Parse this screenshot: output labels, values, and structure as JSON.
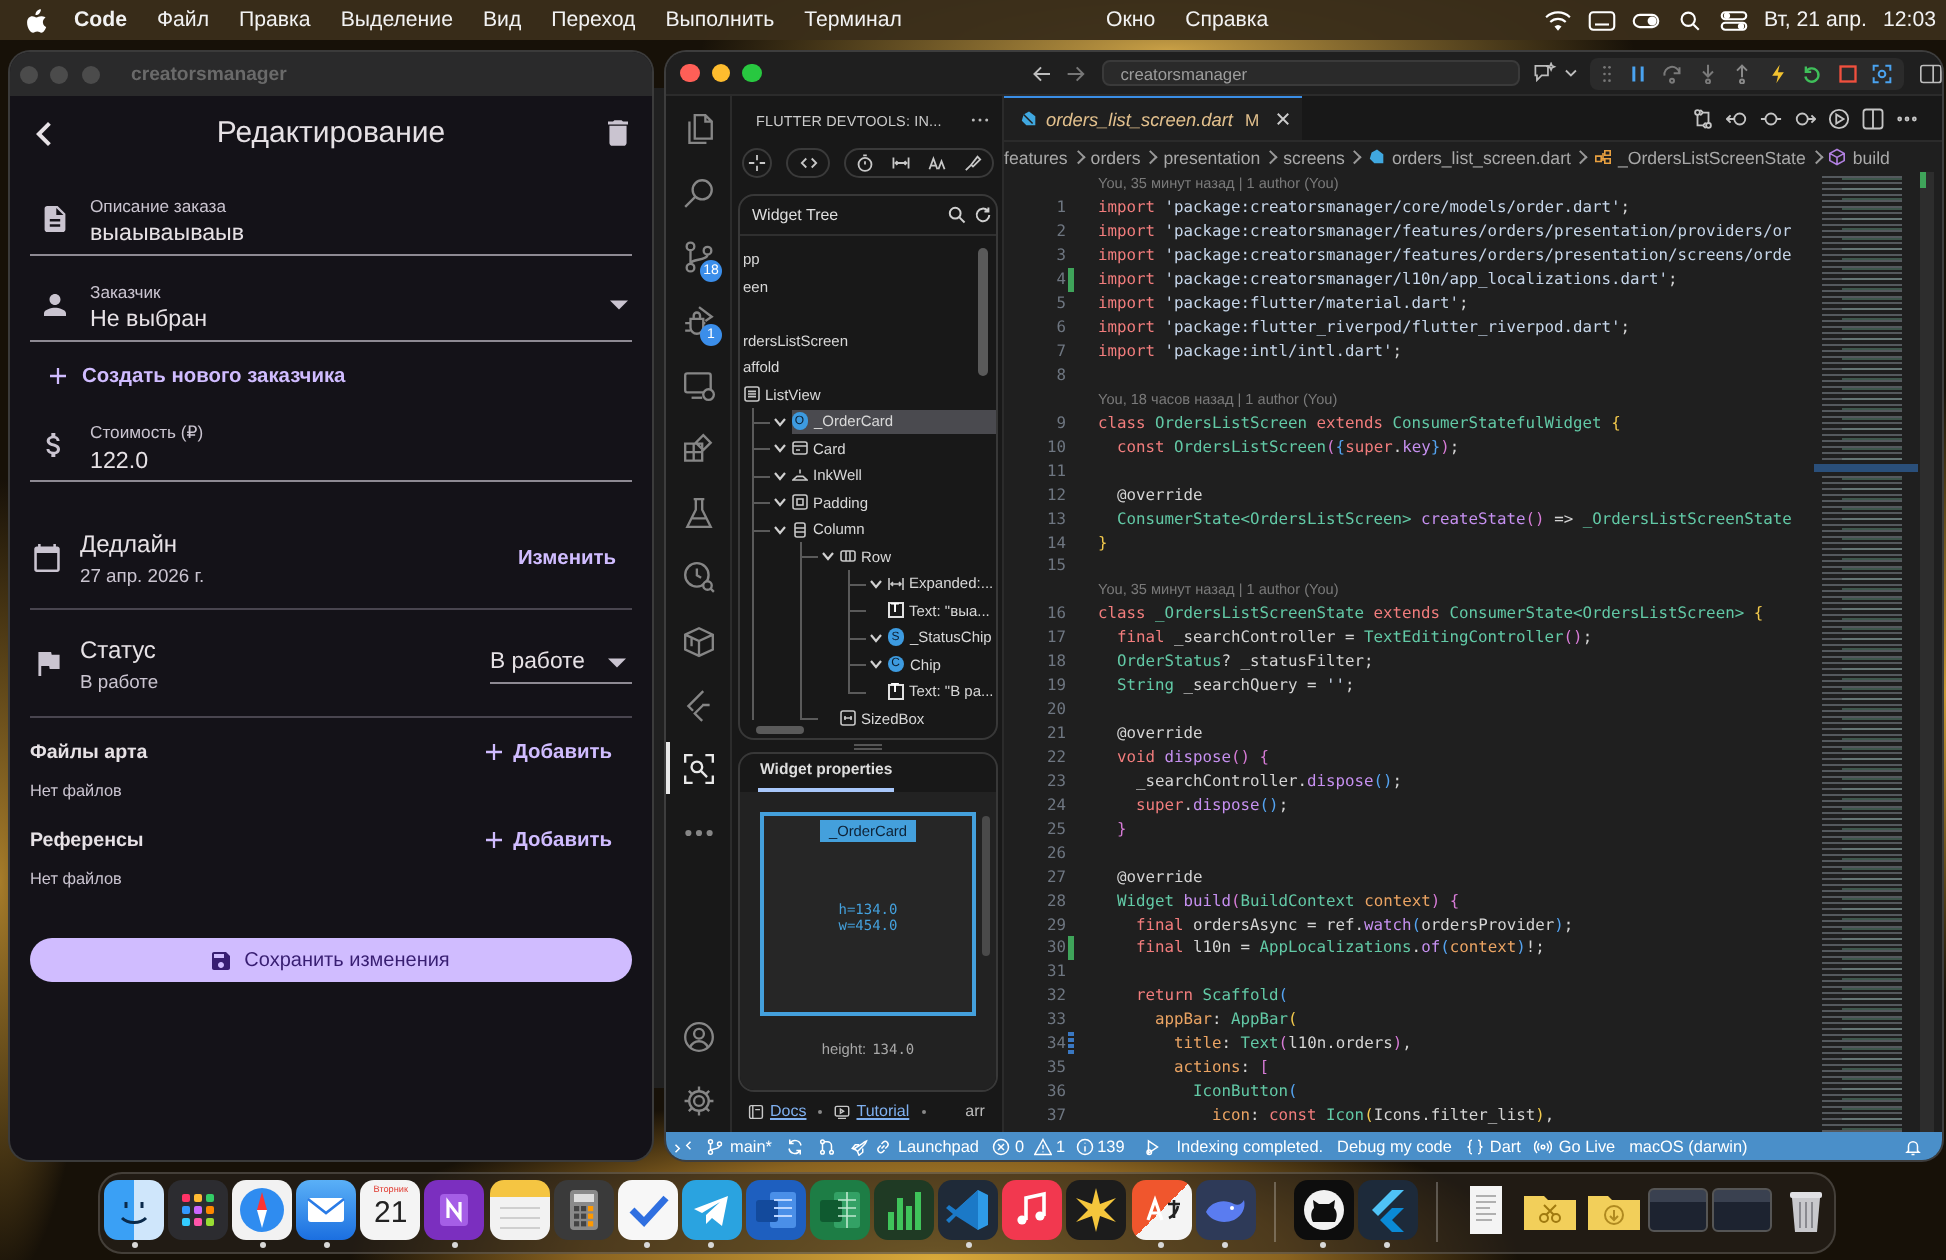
{
  "menu_bar": {
    "app_name": "Code",
    "menus": [
      "Файл",
      "Правка",
      "Выделение",
      "Вид",
      "Переход",
      "Выполнить",
      "Терминал"
    ],
    "more_menus": [
      "Окно",
      "Справка"
    ],
    "date": "Вт, 21 апр.",
    "time": "12:03"
  },
  "app_window": {
    "title": "creatorsmanager",
    "focused": false,
    "header_title": "Редактирование",
    "description_field": {
      "label": "Описание заказа",
      "value": "выаываываыв"
    },
    "customer_field": {
      "label": "Заказчик",
      "value": "Не выбран"
    },
    "create_customer_link": "Создать нового заказчика",
    "price_field": {
      "label": "Стоимость (₽)",
      "value": "122.0"
    },
    "deadline": {
      "title": "Дедлайн",
      "value": "27 апр. 2026 г.",
      "action": "Изменить"
    },
    "status": {
      "title": "Статус",
      "value": "В работе",
      "selected_option": "В работе"
    },
    "attachment_sections": [
      {
        "title": "Файлы арта",
        "add_label": "Добавить",
        "empty_text": "Нет файлов"
      },
      {
        "title": "Референсы",
        "add_label": "Добавить",
        "empty_text": "Нет файлов"
      }
    ],
    "save_button": "Сохранить изменения"
  },
  "editor_window": {
    "focused": true,
    "command_center": "creatorsmanager",
    "activity_bar": [
      {
        "kind": "explorer",
        "selected": false
      },
      {
        "kind": "search",
        "selected": false
      },
      {
        "kind": "scm",
        "selected": false,
        "badge": "18"
      },
      {
        "kind": "debug",
        "selected": false,
        "badge": "1"
      },
      {
        "kind": "remote",
        "selected": false
      },
      {
        "kind": "extensions",
        "selected": false
      },
      {
        "kind": "testing",
        "selected": false
      },
      {
        "kind": "history",
        "selected": false
      },
      {
        "kind": "packages",
        "selected": false
      },
      {
        "kind": "flutter",
        "selected": false
      },
      {
        "kind": "inspector",
        "selected": true
      },
      {
        "kind": "more",
        "selected": false
      }
    ],
    "side_panel": {
      "title": "FLUTTER DEVTOOLS: IN...",
      "widget_tree": {
        "title": "Widget Tree",
        "nodes": [
          {
            "name": "pp",
            "selected": false
          },
          {
            "name": "een",
            "selected": false
          },
          {
            "name": "rdersListScreen",
            "selected": false
          },
          {
            "name": "affold",
            "selected": false
          },
          {
            "name": "ListView",
            "kind": "list",
            "selected": false,
            "children": [
              {
                "name": "_OrderCard",
                "kind": "widget",
                "letter": "O",
                "expanded": true,
                "selected": true
              },
              {
                "name": "Card",
                "kind": "card",
                "expanded": true,
                "selected": false
              },
              {
                "name": "InkWell",
                "kind": "ink",
                "expanded": true,
                "selected": false
              },
              {
                "name": "Padding",
                "kind": "padding",
                "expanded": true,
                "selected": false
              },
              {
                "name": "Column",
                "kind": "column",
                "expanded": true,
                "selected": false,
                "children": [
                  {
                    "name": "Row",
                    "kind": "row",
                    "expanded": true,
                    "selected": false,
                    "children": [
                      {
                        "name": "Expanded:...",
                        "kind": "expanded",
                        "expanded": true,
                        "selected": false
                      },
                      {
                        "name": "Text: \"выа...",
                        "kind": "text",
                        "letter": "T",
                        "selected": false
                      },
                      {
                        "name": "_StatusChip",
                        "kind": "widget",
                        "letter": "S",
                        "expanded": true,
                        "selected": false
                      },
                      {
                        "name": "Chip",
                        "kind": "widget",
                        "letter": "C",
                        "expanded": true,
                        "selected": false
                      },
                      {
                        "name": "Text: \"В ра...",
                        "kind": "text",
                        "letter": "T",
                        "selected": false
                      }
                    ]
                  },
                  {
                    "name": "SizedBox",
                    "kind": "sizedbox",
                    "selected": false
                  }
                ]
              }
            ]
          }
        ]
      },
      "properties": {
        "tabs": [
          {
            "label": "Widget properties",
            "selected": true
          }
        ],
        "widget": "_OrderCard",
        "height_label": "h=134.0",
        "width_label": "w=454.0",
        "detail_name": "height:",
        "detail_value": "134.0"
      },
      "links": [
        {
          "kind": "book",
          "label": "Docs"
        },
        {
          "kind": "video",
          "label": "Tutorial"
        },
        {
          "label": "arr"
        }
      ]
    },
    "tabs": [
      {
        "label": "orders_list_screen.dart",
        "status": "M",
        "selected": true
      }
    ],
    "breadcrumbs": [
      {
        "label": "features"
      },
      {
        "label": "orders"
      },
      {
        "label": "presentation"
      },
      {
        "label": "screens"
      },
      {
        "label": "orders_list_screen.dart",
        "kind": "file"
      },
      {
        "label": "_OrdersListScreenState",
        "kind": "class"
      },
      {
        "label": "build",
        "kind": "method"
      }
    ],
    "lines": [
      {
        "kind": "blame",
        "text": "You, 35 минут назад | 1 author (You)"
      },
      {
        "kind": "code",
        "number": "1",
        "tokens": [
          {
            "kind": "keyword",
            "text": "import "
          },
          {
            "kind": "string",
            "text": "'package:creatorsmanager/core/models/order.dart'"
          },
          {
            "kind": "text",
            "text": ";"
          }
        ]
      },
      {
        "kind": "code",
        "number": "2",
        "tokens": [
          {
            "kind": "keyword",
            "text": "import "
          },
          {
            "kind": "string",
            "text": "'package:creatorsmanager/features/orders/presentation/providers/or"
          }
        ]
      },
      {
        "kind": "code",
        "number": "3",
        "tokens": [
          {
            "kind": "keyword",
            "text": "import "
          },
          {
            "kind": "string",
            "text": "'package:creatorsmanager/features/orders/presentation/screens/orde"
          }
        ]
      },
      {
        "kind": "code",
        "number": "4",
        "added": true,
        "tokens": [
          {
            "kind": "keyword",
            "text": "import "
          },
          {
            "kind": "string",
            "text": "'package:creatorsmanager/l10n/app_localizations.dart'"
          },
          {
            "kind": "text",
            "text": ";"
          }
        ]
      },
      {
        "kind": "code",
        "number": "5",
        "tokens": [
          {
            "kind": "keyword",
            "text": "import "
          },
          {
            "kind": "string",
            "text": "'package:flutter/material.dart'"
          },
          {
            "kind": "text",
            "text": ";"
          }
        ]
      },
      {
        "kind": "code",
        "number": "6",
        "tokens": [
          {
            "kind": "keyword",
            "text": "import "
          },
          {
            "kind": "string",
            "text": "'package:flutter_riverpod/flutter_riverpod.dart'"
          },
          {
            "kind": "text",
            "text": ";"
          }
        ]
      },
      {
        "kind": "code",
        "number": "7",
        "tokens": [
          {
            "kind": "keyword",
            "text": "import "
          },
          {
            "kind": "string",
            "text": "'package:intl/intl.dart'"
          },
          {
            "kind": "text",
            "text": ";"
          }
        ]
      },
      {
        "kind": "code",
        "number": "8"
      },
      {
        "kind": "blame",
        "text": "You, 18 часов назад | 1 author (You)"
      },
      {
        "kind": "code",
        "number": "9",
        "tokens": [
          {
            "kind": "keyword",
            "text": "class "
          },
          {
            "kind": "type",
            "text": "OrdersListScreen "
          },
          {
            "kind": "keyword",
            "text": "extends "
          },
          {
            "kind": "type",
            "text": "ConsumerStatefulWidget "
          },
          {
            "kind": "brace1",
            "text": "{"
          }
        ]
      },
      {
        "kind": "code",
        "number": "10",
        "tokens": [
          {
            "kind": "keyword",
            "text": "  const "
          },
          {
            "kind": "type",
            "text": "OrdersListScreen"
          },
          {
            "kind": "brace2",
            "text": "("
          },
          {
            "kind": "brace3",
            "text": "{"
          },
          {
            "kind": "keyword",
            "text": "super"
          },
          {
            "kind": "text",
            "text": "."
          },
          {
            "kind": "function",
            "text": "key"
          },
          {
            "kind": "brace3",
            "text": "}"
          },
          {
            "kind": "brace2",
            "text": ")"
          },
          {
            "kind": "text",
            "text": ";"
          }
        ]
      },
      {
        "kind": "code",
        "number": "11"
      },
      {
        "kind": "code",
        "number": "12",
        "tokens": [
          {
            "kind": "text",
            "text": "  @override"
          }
        ]
      },
      {
        "kind": "code",
        "number": "13",
        "tokens": [
          {
            "kind": "type",
            "text": "  ConsumerState<OrdersListScreen> "
          },
          {
            "kind": "function",
            "text": "createState"
          },
          {
            "kind": "brace2",
            "text": "()"
          },
          {
            "kind": "text",
            "text": " => "
          },
          {
            "kind": "type",
            "text": "_OrdersListScreenState"
          }
        ]
      },
      {
        "kind": "code",
        "number": "14",
        "tokens": [
          {
            "kind": "brace1",
            "text": "}"
          }
        ]
      },
      {
        "kind": "code",
        "number": "15"
      },
      {
        "kind": "blame",
        "text": "You, 35 минут назад | 1 author (You)"
      },
      {
        "kind": "code",
        "number": "16",
        "tokens": [
          {
            "kind": "keyword",
            "text": "class "
          },
          {
            "kind": "type",
            "text": "_OrdersListScreenState "
          },
          {
            "kind": "keyword",
            "text": "extends "
          },
          {
            "kind": "type",
            "text": "ConsumerState<OrdersListScreen> "
          },
          {
            "kind": "brace1",
            "text": "{"
          }
        ]
      },
      {
        "kind": "code",
        "number": "17",
        "tokens": [
          {
            "kind": "keyword",
            "text": "  final "
          },
          {
            "kind": "text",
            "text": "_searchController = "
          },
          {
            "kind": "type",
            "text": "TextEditingController"
          },
          {
            "kind": "brace2",
            "text": "()"
          },
          {
            "kind": "text",
            "text": ";"
          }
        ]
      },
      {
        "kind": "code",
        "number": "18",
        "tokens": [
          {
            "kind": "type",
            "text": "  OrderStatus"
          },
          {
            "kind": "text",
            "text": "? _statusFilter;"
          }
        ]
      },
      {
        "kind": "code",
        "number": "19",
        "tokens": [
          {
            "kind": "type",
            "text": "  String "
          },
          {
            "kind": "text",
            "text": "_searchQuery = "
          },
          {
            "kind": "string",
            "text": "''"
          },
          {
            "kind": "text",
            "text": ";"
          }
        ]
      },
      {
        "kind": "code",
        "number": "20"
      },
      {
        "kind": "code",
        "number": "21",
        "tokens": [
          {
            "kind": "text",
            "text": "  @override"
          }
        ]
      },
      {
        "kind": "code",
        "number": "22",
        "tokens": [
          {
            "kind": "keyword",
            "text": "  void "
          },
          {
            "kind": "function",
            "text": "dispose"
          },
          {
            "kind": "brace2",
            "text": "() {"
          }
        ]
      },
      {
        "kind": "code",
        "number": "23",
        "tokens": [
          {
            "kind": "text",
            "text": "    _searchController."
          },
          {
            "kind": "function",
            "text": "dispose"
          },
          {
            "kind": "brace3",
            "text": "()"
          },
          {
            "kind": "text",
            "text": ";"
          }
        ]
      },
      {
        "kind": "code",
        "number": "24",
        "tokens": [
          {
            "kind": "keyword",
            "text": "    super"
          },
          {
            "kind": "text",
            "text": "."
          },
          {
            "kind": "function",
            "text": "dispose"
          },
          {
            "kind": "brace3",
            "text": "()"
          },
          {
            "kind": "text",
            "text": ";"
          }
        ]
      },
      {
        "kind": "code",
        "number": "25",
        "tokens": [
          {
            "kind": "brace2",
            "text": "  }"
          }
        ]
      },
      {
        "kind": "code",
        "number": "26"
      },
      {
        "kind": "code",
        "number": "27",
        "tokens": [
          {
            "kind": "text",
            "text": "  @override"
          }
        ]
      },
      {
        "kind": "code",
        "number": "28",
        "tokens": [
          {
            "kind": "type",
            "text": "  Widget "
          },
          {
            "kind": "function",
            "text": "build"
          },
          {
            "kind": "brace2",
            "text": "("
          },
          {
            "kind": "type",
            "text": "BuildContext "
          },
          {
            "kind": "param",
            "text": "context"
          },
          {
            "kind": "brace2",
            "text": ") {"
          }
        ]
      },
      {
        "kind": "code",
        "number": "29",
        "tokens": [
          {
            "kind": "keyword",
            "text": "    final "
          },
          {
            "kind": "text",
            "text": "ordersAsync = ref."
          },
          {
            "kind": "function",
            "text": "watch"
          },
          {
            "kind": "brace3",
            "text": "("
          },
          {
            "kind": "text",
            "text": "ordersProvider"
          },
          {
            "kind": "brace3",
            "text": ")"
          },
          {
            "kind": "text",
            "text": ";"
          }
        ]
      },
      {
        "kind": "code",
        "number": "30",
        "added": true,
        "tokens": [
          {
            "kind": "keyword",
            "text": "    final "
          },
          {
            "kind": "text",
            "text": "l10n = "
          },
          {
            "kind": "type",
            "text": "AppLocalizations"
          },
          {
            "kind": "text",
            "text": "."
          },
          {
            "kind": "function",
            "text": "of"
          },
          {
            "kind": "brace3",
            "text": "("
          },
          {
            "kind": "param",
            "text": "context"
          },
          {
            "kind": "brace3",
            "text": ")"
          },
          {
            "kind": "text",
            "text": "!;"
          }
        ]
      },
      {
        "kind": "code",
        "number": "31"
      },
      {
        "kind": "code",
        "number": "32",
        "tokens": [
          {
            "kind": "keyword",
            "text": "    return "
          },
          {
            "kind": "type",
            "text": "Scaffold"
          },
          {
            "kind": "brace3",
            "text": "("
          }
        ]
      },
      {
        "kind": "code",
        "number": "33",
        "tokens": [
          {
            "kind": "param",
            "text": "      appBar"
          },
          {
            "kind": "text",
            "text": ": "
          },
          {
            "kind": "type",
            "text": "AppBar"
          },
          {
            "kind": "brace1",
            "text": "("
          }
        ]
      },
      {
        "kind": "code",
        "number": "34",
        "modified": true,
        "tokens": [
          {
            "kind": "param",
            "text": "        title"
          },
          {
            "kind": "text",
            "text": ": "
          },
          {
            "kind": "type",
            "text": "Text"
          },
          {
            "kind": "brace2",
            "text": "("
          },
          {
            "kind": "text",
            "text": "l10n.orders"
          },
          {
            "kind": "brace2",
            "text": ")"
          },
          {
            "kind": "text",
            "text": ","
          }
        ]
      },
      {
        "kind": "code",
        "number": "35",
        "tokens": [
          {
            "kind": "param",
            "text": "        actions"
          },
          {
            "kind": "text",
            "text": ": "
          },
          {
            "kind": "brace2",
            "text": "["
          }
        ]
      },
      {
        "kind": "code",
        "number": "36",
        "tokens": [
          {
            "kind": "type",
            "text": "          IconButton"
          },
          {
            "kind": "brace3",
            "text": "("
          }
        ]
      },
      {
        "kind": "code",
        "number": "37",
        "tokens": [
          {
            "kind": "param",
            "text": "            icon"
          },
          {
            "kind": "text",
            "text": ": "
          },
          {
            "kind": "keyword",
            "text": "const "
          },
          {
            "kind": "type",
            "text": "Icon"
          },
          {
            "kind": "brace1",
            "text": "("
          },
          {
            "kind": "text",
            "text": "Icons.filter_list"
          },
          {
            "kind": "brace1",
            "text": ")"
          },
          {
            "kind": "text",
            "text": ","
          }
        ]
      }
    ],
    "status_bar": {
      "branch": "main*",
      "launchpad": "Launchpad",
      "errors": "0",
      "warnings": "1",
      "infos": "139",
      "message": "Indexing completed.",
      "debug_mode": "Debug my code",
      "language": "Dart",
      "live_server": "Go Live",
      "device": "macOS (darwin)"
    }
  },
  "dock": {
    "sections": [
      {
        "apps": [
          {
            "kind": "face",
            "running": true
          },
          {
            "kind": "grid",
            "running": false
          },
          {
            "kind": "compass",
            "running": true
          },
          {
            "kind": "envelope",
            "running": true
          },
          {
            "kind": "calendar",
            "running": false,
            "weekday": "Вторник",
            "day": "21"
          },
          {
            "kind": "notebook",
            "running": true
          },
          {
            "kind": "notepad",
            "running": false
          },
          {
            "kind": "calculator",
            "running": false
          },
          {
            "kind": "checkmark",
            "running": true
          },
          {
            "kind": "plane",
            "running": true
          },
          {
            "kind": "wordsheet",
            "running": false
          },
          {
            "kind": "spreadsheet",
            "running": false
          },
          {
            "kind": "chart",
            "running": false
          },
          {
            "kind": "ribbon",
            "running": true
          },
          {
            "kind": "note",
            "running": false
          },
          {
            "kind": "starburst",
            "running": false
          },
          {
            "kind": "translate",
            "running": true
          },
          {
            "kind": "whale",
            "running": true
          }
        ]
      },
      {
        "apps": [
          {
            "kind": "cat",
            "running": true
          },
          {
            "kind": "chevron",
            "running": true
          }
        ]
      },
      {
        "apps": [
          {
            "kind": "page",
            "running": false
          },
          {
            "kind": "scissors",
            "running": false
          },
          {
            "kind": "download",
            "running": false
          },
          {
            "kind": "window",
            "running": false
          },
          {
            "kind": "window",
            "running": false
          },
          {
            "kind": "trash",
            "running": false
          }
        ]
      }
    ]
  }
}
